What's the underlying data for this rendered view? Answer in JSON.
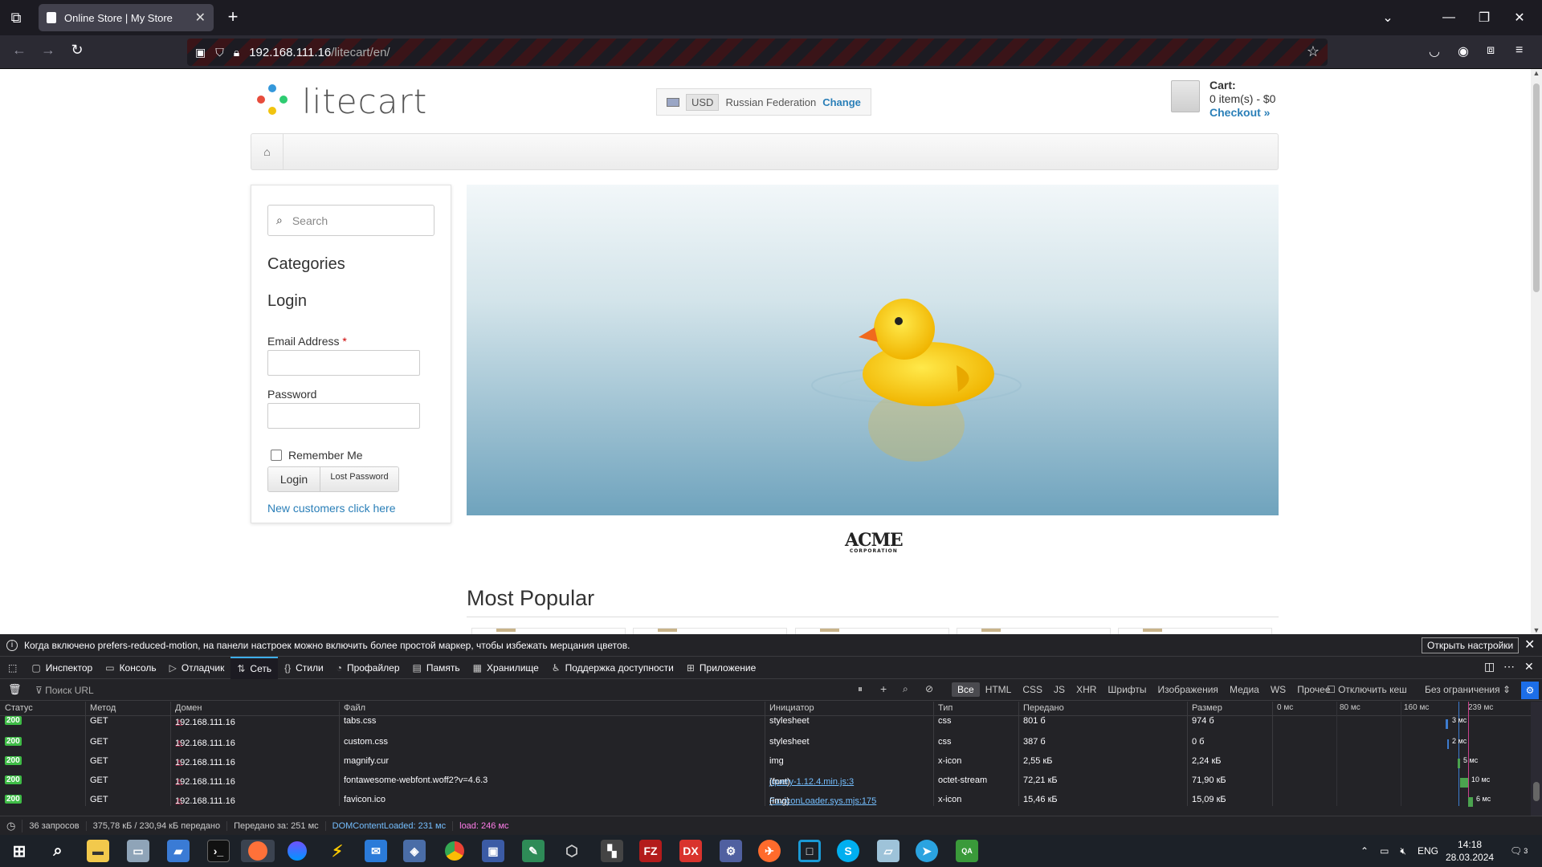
{
  "browser": {
    "tab_title": "Online Store | My Store",
    "url_host": "192.168.111.16",
    "url_path": "/litecart/en/"
  },
  "site": {
    "logo_text": "litecart",
    "currency": "USD",
    "country": "Russian Federation",
    "change_label": "Change",
    "cart_title": "Cart:",
    "cart_count": "0 item(s) - $0",
    "checkout": "Checkout »"
  },
  "sidebar": {
    "search_placeholder": "Search",
    "categories": "Categories",
    "login_title": "Login",
    "email_label": "Email Address",
    "email_required": "*",
    "password_label": "Password",
    "remember_label": "Remember Me",
    "login_button": "Login",
    "lost_password_button": "Lost Password",
    "new_customers": "New customers click here"
  },
  "main": {
    "brand_logo": "ACME",
    "brand_sub": "CORPORATION",
    "most_popular": "Most Popular"
  },
  "devtools": {
    "notice": "Когда включено prefers-reduced-motion, на панели настроек можно включить более простой маркер, чтобы избежать мерцания цветов.",
    "notice_button": "Открыть настройки",
    "tabs": [
      {
        "label": "Инспектор",
        "icon": "inspector-icon"
      },
      {
        "label": "Консоль",
        "icon": "console-icon"
      },
      {
        "label": "Отладчик",
        "icon": "debugger-icon"
      },
      {
        "label": "Сеть",
        "icon": "network-icon"
      },
      {
        "label": "Стили",
        "icon": "styles-icon"
      },
      {
        "label": "Профайлер",
        "icon": "profiler-icon"
      },
      {
        "label": "Память",
        "icon": "memory-icon"
      },
      {
        "label": "Хранилище",
        "icon": "storage-icon"
      },
      {
        "label": "Поддержка доступности",
        "icon": "accessibility-icon"
      },
      {
        "label": "Приложение",
        "icon": "application-icon"
      }
    ],
    "filter_url_placeholder": "Поиск URL",
    "filters": [
      "Все",
      "HTML",
      "CSS",
      "JS",
      "XHR",
      "Шрифты",
      "Изображения",
      "Медиа",
      "WS",
      "Прочее"
    ],
    "disable_cache": "Отключить кеш",
    "throttle": "Без ограничения ⇕",
    "columns": [
      "Статус",
      "Метод",
      "Домен",
      "Файл",
      "Инициатор",
      "Тип",
      "Передано",
      "Размер"
    ],
    "waterfall_ticks": [
      "0 мс",
      "80 мс",
      "160 мс",
      "239 мс"
    ],
    "rows": [
      {
        "status": "200",
        "method": "GET",
        "domain": "192.168.111.16",
        "file": "tabs.css",
        "initiator": "stylesheet",
        "initiator_suffix": "",
        "type": "css",
        "transferred": "801 б",
        "size": "974 б",
        "time": "3 мс"
      },
      {
        "status": "200",
        "method": "GET",
        "domain": "192.168.111.16",
        "file": "custom.css",
        "initiator": "stylesheet",
        "initiator_suffix": "",
        "type": "css",
        "transferred": "387 б",
        "size": "0 б",
        "time": "2 мс"
      },
      {
        "status": "200",
        "method": "GET",
        "domain": "192.168.111.16",
        "file": "magnify.cur",
        "initiator": "img",
        "initiator_suffix": "",
        "type": "x-icon",
        "transferred": "2,55 кБ",
        "size": "2,24 кБ",
        "time": "5 мс"
      },
      {
        "status": "200",
        "method": "GET",
        "domain": "192.168.111.16",
        "file": "fontawesome-webfont.woff2?v=4.6.3",
        "initiator": "jquery-1.12.4.min.js:3",
        "initiator_suffix": "(font)",
        "type": "octet-stream",
        "transferred": "72,21 кБ",
        "size": "71,90 кБ",
        "time": "10 мс"
      },
      {
        "status": "200",
        "method": "GET",
        "domain": "192.168.111.16",
        "file": "favicon.ico",
        "initiator": "FaviconLoader.sys.mjs:175",
        "initiator_suffix": "(img)",
        "type": "x-icon",
        "transferred": "15,46 кБ",
        "size": "15,09 кБ",
        "time": "6 мс"
      }
    ],
    "summary": {
      "requests": "36 запросов",
      "transferred": "375,78 кБ / 230,94 кБ передано",
      "finish": "Передано за: 251 мс",
      "dcl": "DOMContentLoaded: 231 мс",
      "load": "load: 246 мс"
    }
  },
  "taskbar": {
    "lang": "ENG",
    "time": "14:18",
    "date": "28.03.2024",
    "notifications": "3"
  }
}
